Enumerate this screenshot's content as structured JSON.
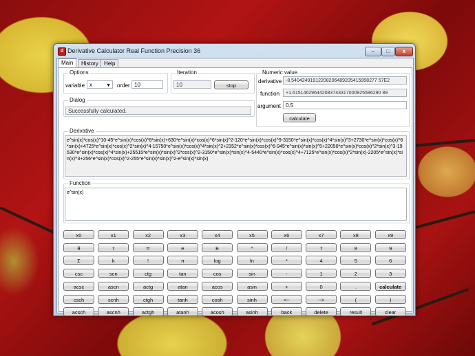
{
  "window": {
    "title": "Derivative Calculator Real Function Precision 36",
    "icon": "app-icon",
    "controls": {
      "minimize": "–",
      "maximize": "□",
      "close": "x"
    }
  },
  "tabs": [
    "Main",
    "History",
    "Help"
  ],
  "options": {
    "group_label": "Options",
    "variable_label": "variable",
    "variable_value": "x",
    "order_label": "order",
    "order_value": "10"
  },
  "iteration": {
    "group_label": "Iteration",
    "value": "10",
    "stop_label": "stop"
  },
  "dialog": {
    "group_label": "Dialog",
    "message": "Successfully calculated."
  },
  "numeric": {
    "group_label": "Numeric value",
    "derivative_label": "derivative",
    "derivative_value": "-8.54042491912208206489205415958277 57E2",
    "function_label": "function",
    "function_value": "+1.615146296442083743317000925586290 89",
    "argument_label": "argument",
    "argument_value": "0.5",
    "calculate_label": "calculate"
  },
  "derivative": {
    "group_label": "Derivative",
    "text": "e^sin(x)*cos(x)^10-45*e^sin(x)*cos(x)^8*sin(x)+630*e^sin(x)*cos(x)^6*sin(x)^2-120*e^sin(x)*cos(x)^9-3150*e^sin(x)*cos(x)^4*sin(x)^3+2730*e^sin(x)*cos(x)^6*sin(x)+4725*e^sin(x)*cos(x)^2*sin(x)^4-15750*e^sin(x)*cos(x)^4*sin(x)^2+2352*e^sin(x)*cos(x)^6-945*e^sin(x)*sin(x)^5+22050*e^sin(x)*cos(x)^2*sin(x)^3-19530*e^sin(x)*cos(x)^4*sin(x)+25515*e^sin(x)*sin(x)^2*cos(x)^2-3150*e^sin(x)*sin(x)^4-5440*e^sin(x)*cos(x)^4+7125*e^sin(x)*cos(x)^2*sin(x)-2205*e^sin(x)*sin(x)^3+256*e^sin(x)*cos(x)^2-255*e^sin(x)*sin(x)^2-e^sin(x)*sin(x)"
  },
  "function": {
    "group_label": "Function",
    "text": "e^sin(x)"
  },
  "keypad": [
    [
      "x0",
      "x1",
      "x2",
      "x3",
      "x4",
      "x5",
      "x6",
      "x7",
      "x8",
      "x9"
    ],
    [
      "θ",
      "τ",
      "π",
      "e",
      "E",
      "^",
      "/",
      "7",
      "8",
      "9"
    ],
    [
      "Σ",
      "k",
      "!",
      "π",
      "log",
      "ln",
      "*",
      "4",
      "5",
      "6"
    ],
    [
      "csc",
      "scn",
      "ctg",
      "tan",
      "cos",
      "sin",
      "-",
      "1",
      "2",
      "3"
    ],
    [
      "acsc",
      "ascn",
      "actg",
      "atan",
      "acos",
      "asin",
      "+",
      "0",
      ".",
      "calculate"
    ],
    [
      "csch",
      "scnh",
      "ctgh",
      "tanh",
      "cosh",
      "sinh",
      "<--",
      "-->",
      "(",
      ")"
    ],
    [
      "acsch",
      "ascnh",
      "actgh",
      "atanh",
      "acosh",
      "asinh",
      "back",
      "delete",
      "result",
      "clear"
    ]
  ]
}
